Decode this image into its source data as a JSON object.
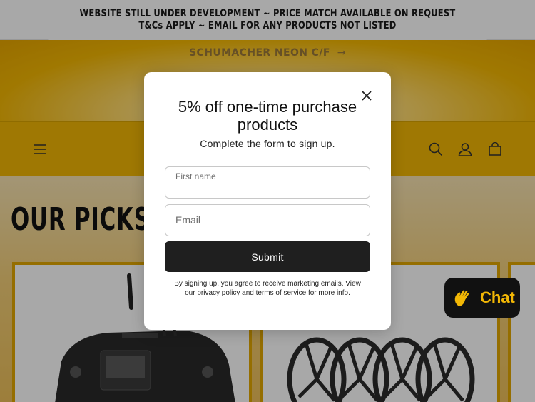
{
  "announcement": {
    "text": "WEBSITE STILL UNDER DEVELOPMENT ~ PRICE MATCH AVAILABLE ON REQUEST T&Cs APPLY ~ EMAIL FOR ANY PRODUCTS NOT LISTED"
  },
  "promo": {
    "link_text": "SCHUMACHER NEON C/F",
    "arrow": "→"
  },
  "header": {
    "icons": [
      "menu-icon",
      "search-icon",
      "account-icon",
      "cart-icon"
    ]
  },
  "section": {
    "title": "OUR PICKS"
  },
  "modal": {
    "title": "5% off one-time purchase products",
    "subtitle": "Complete the form to sign up.",
    "first_name_label": "First name",
    "email_placeholder": "Email",
    "submit_label": "Submit",
    "legal_text": "By signing up, you agree to receive marketing emails. View our privacy policy and terms of service for more info."
  },
  "chat": {
    "label": "Chat",
    "icon": "wave-hand-icon"
  },
  "colors": {
    "brand_yellow": "#f2b705",
    "dark": "#1f1f1f"
  }
}
